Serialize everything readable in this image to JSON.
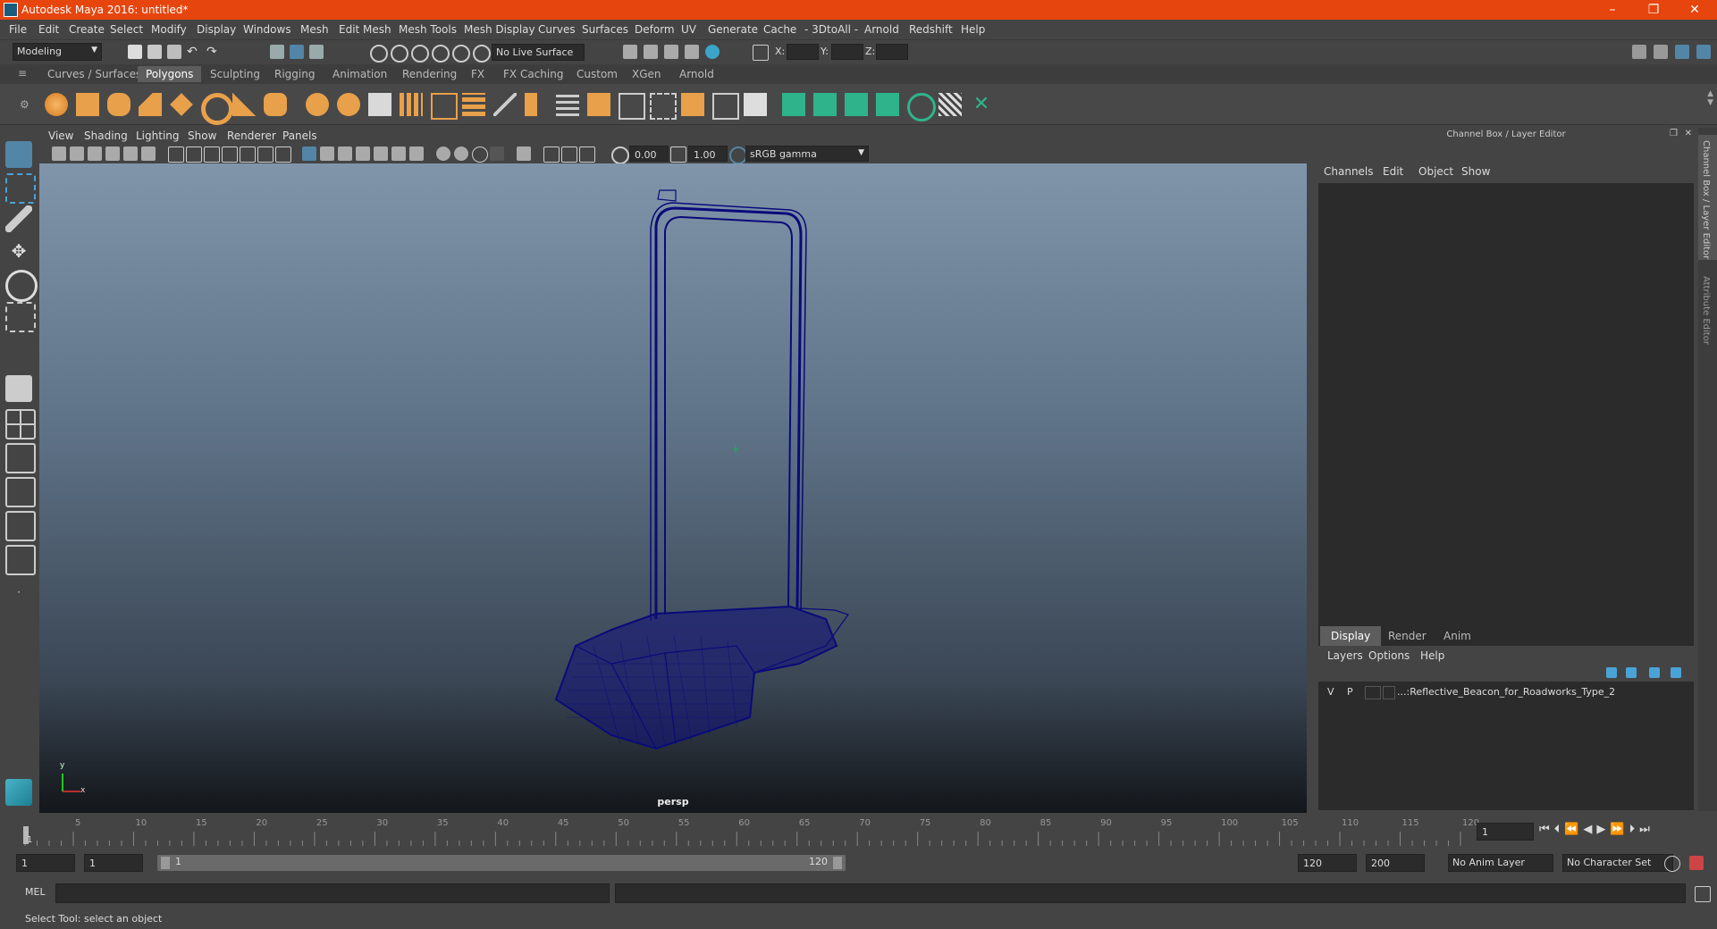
{
  "window": {
    "title": "Autodesk Maya 2016: untitled*",
    "minimize": "–",
    "restore": "❐",
    "close": "✕"
  },
  "menus": [
    "File",
    "Edit",
    "Create",
    "Select",
    "Modify",
    "Display",
    "Windows",
    "Mesh",
    "Edit Mesh",
    "Mesh Tools",
    "Mesh Display",
    "Curves",
    "Surfaces",
    "Deform",
    "UV",
    "Generate",
    "Cache",
    "- 3DtoAll -",
    "Arnold",
    "Redshift",
    "Help"
  ],
  "statusline": {
    "mode": "Modeling",
    "live_surface": "No Live Surface",
    "x_label": "X:",
    "y_label": "Y:",
    "z_label": "Z:"
  },
  "shelf_tabs": [
    "Curves / Surfaces",
    "Polygons",
    "Sculpting",
    "Rigging",
    "Animation",
    "Rendering",
    "FX",
    "FX Caching",
    "Custom",
    "XGen",
    "Arnold"
  ],
  "shelf_active": "Polygons",
  "viewport": {
    "menus": [
      "View",
      "Shading",
      "Lighting",
      "Show",
      "Renderer",
      "Panels"
    ],
    "exposure": "0.00",
    "gamma": "1.00",
    "color_space": "sRGB gamma",
    "camera_label": "persp",
    "axis_x": "x",
    "axis_y": "y"
  },
  "channel_box": {
    "header": "Channel Box / Layer Editor",
    "menus": [
      "Channels",
      "Edit",
      "Object",
      "Show"
    ],
    "layer_tabs": [
      "Display",
      "Render",
      "Anim"
    ],
    "layer_tab_active": "Display",
    "layer_menus": [
      "Layers",
      "Options",
      "Help"
    ],
    "layer": {
      "v": "V",
      "p": "P",
      "name": "...:Reflective_Beacon_for_Roadworks_Type_2"
    }
  },
  "side_tabs": [
    "Channel Box / Layer Editor",
    "Attribute Editor"
  ],
  "timeslider": {
    "ticks": [
      "1",
      "5",
      "10",
      "15",
      "20",
      "25",
      "30",
      "35",
      "40",
      "45",
      "50",
      "55",
      "60",
      "65",
      "70",
      "75",
      "80",
      "85",
      "90",
      "95",
      "100",
      "105",
      "110",
      "115",
      "120"
    ],
    "current_frame": "1"
  },
  "range": {
    "start": "1",
    "playback_start": "1",
    "slider_start": "1",
    "slider_end": "120",
    "playback_end": "120",
    "end": "200",
    "anim_layer": "No Anim Layer",
    "char_set": "No Character Set"
  },
  "command_line": {
    "label": "MEL"
  },
  "help_line": "Select Tool: select an object",
  "colors": {
    "title_bar": "#e6450e",
    "accent": "#5285a6",
    "wireframe": "#0a0a7a",
    "shelf_orange": "#e8a04a",
    "shelf_green": "#2fb38a"
  }
}
